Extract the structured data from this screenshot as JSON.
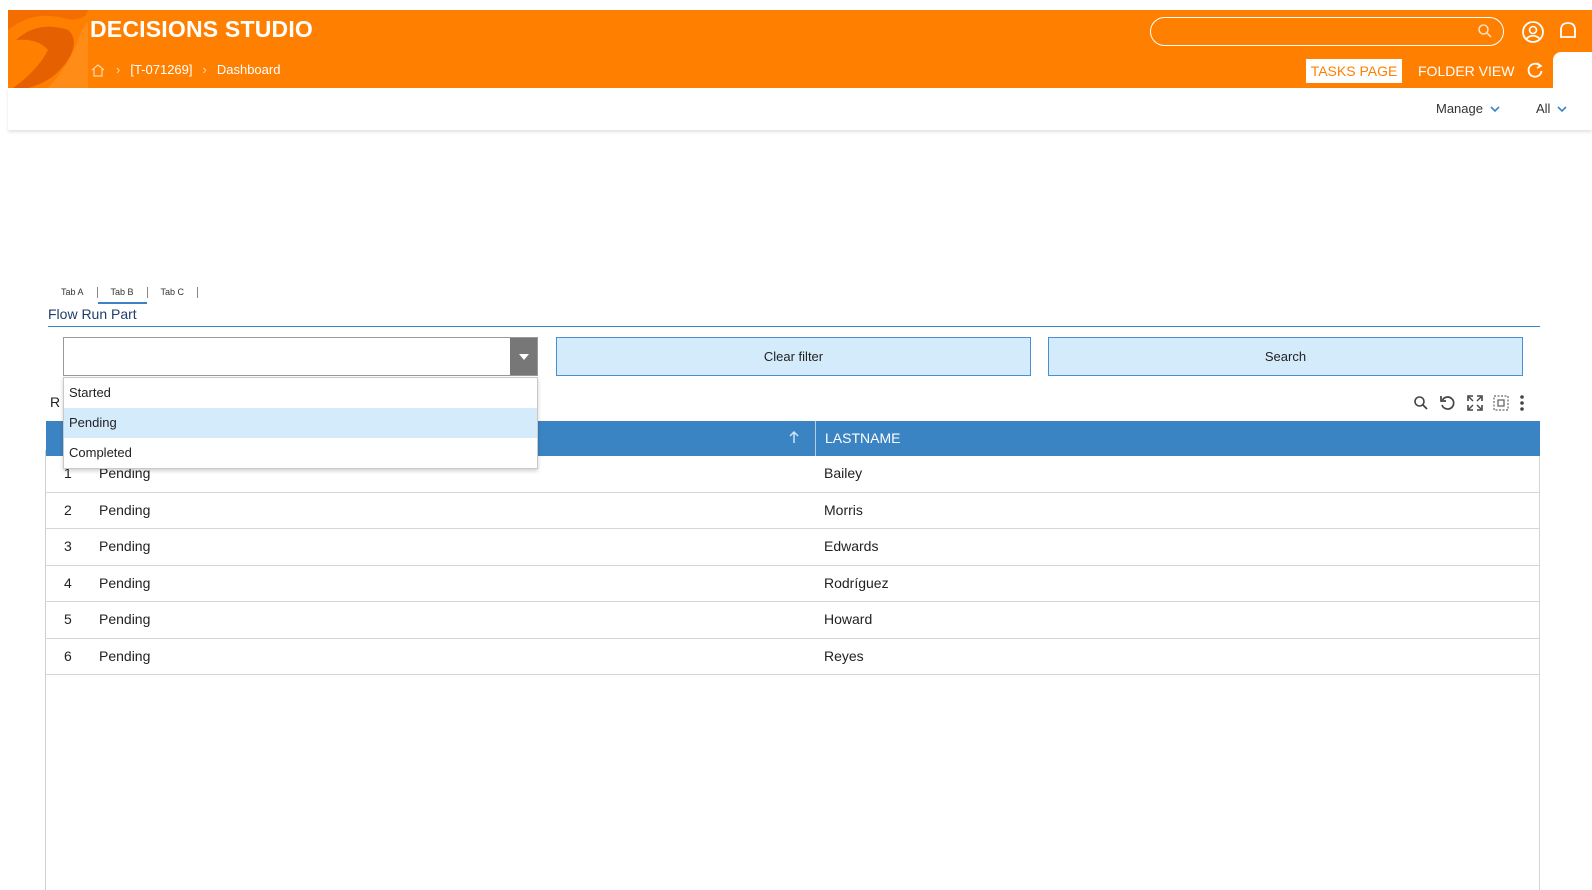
{
  "app": {
    "title": "DECISIONS STUDIO"
  },
  "breadcrumb": {
    "items": [
      "[T-071269]",
      "Dashboard"
    ],
    "home_icon": "home-icon"
  },
  "header": {
    "search_placeholder": "",
    "tasks_button": "TASKS PAGE",
    "folder_button": "FOLDER VIEW",
    "accent": "#ff7f00"
  },
  "subbar": {
    "manage": "Manage",
    "all": "All"
  },
  "tabs": [
    {
      "label": "Tab A",
      "active": false
    },
    {
      "label": "Tab B",
      "active": true
    },
    {
      "label": "Tab C",
      "active": false
    }
  ],
  "section": {
    "title": "Flow Run Part"
  },
  "filter": {
    "combo_value": "",
    "clear_label": "Clear filter",
    "search_label": "Search",
    "options": [
      "Started",
      "Pending",
      "Completed"
    ],
    "highlighted": "Pending"
  },
  "grid": {
    "caption": "R",
    "columns": [
      "",
      "LASTNAME"
    ],
    "header_color": "#3b84c4",
    "rows": [
      {
        "num": "1",
        "status": "Pending",
        "lastname": "Bailey"
      },
      {
        "num": "2",
        "status": "Pending",
        "lastname": "Morris"
      },
      {
        "num": "3",
        "status": "Pending",
        "lastname": "Edwards"
      },
      {
        "num": "4",
        "status": "Pending",
        "lastname": "Rodríguez"
      },
      {
        "num": "5",
        "status": "Pending",
        "lastname": "Howard"
      },
      {
        "num": "6",
        "status": "Pending",
        "lastname": "Reyes"
      }
    ]
  }
}
